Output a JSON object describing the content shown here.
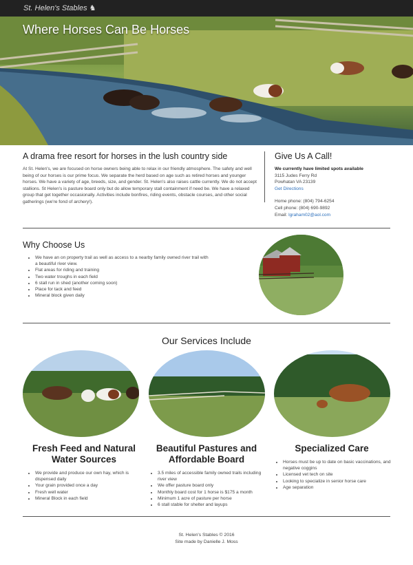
{
  "navbar": {
    "brand": "St. Helen's Stables",
    "brand_icon": "horse-icon"
  },
  "hero": {
    "title": "Where Horses Can Be Horses"
  },
  "intro": {
    "heading": "A drama free resort for horses in the lush country side",
    "text": "At St. Helen's, we are focused on horse owners being able to relax in our friendly atmosphere. The safety and well being of our horses is our prime focus. We separate the herd based on age such as retired horses and younger horses. We have a variety of age, breeds, size, and gender. St. Helen's also raises cattle currently. We do not accept stallions. St Helen's is pasture board only but do allow temporary stall containment if need be. We have a relaxed group that get together occasionally. Activities include bonfires, riding events, obstacle courses, and other social gatherings (we're fond of archery!)."
  },
  "contact": {
    "heading": "Give Us A Call!",
    "availability": "We currently have limited spots available",
    "address_line1": "3115 Judes Ferry Rd",
    "address_line2": "Powhatan VA 23139",
    "directions_link": "Get Directions",
    "home_phone": "Home phone: (804) 794-6254",
    "cell_phone": "Cell phone: (804) 690-9892",
    "email_label": "Email: ",
    "email": "lgraham02@aol.com"
  },
  "why": {
    "heading": "Why Choose Us",
    "items": [
      "We have an on property trail as well as access to a nearby family owned river trail with a beautiful river view.",
      "Flat areas for riding and training",
      "Two water troughs in each field",
      "6 stall run in shed (another coming soon)",
      "Place for tack and feed",
      "Mineral block given daily"
    ]
  },
  "services": {
    "heading": "Our Services Include",
    "columns": [
      {
        "title": "Fresh Feed and Natural Water Sources",
        "items": [
          "We provide and produce our own hay, which is dispensed daily",
          "Your grain provided once a day",
          "Fresh well water",
          "Mineral Block in each field"
        ]
      },
      {
        "title": "Beautiful Pastures and Affordable Board",
        "items": [
          "3.5 miles of accessible family owned trails including river view",
          "We offer pasture board only",
          "Monthly board cost for 1 horse is $175 a month",
          "Minimum 1 acre of pasture per horse",
          "6 stall stable for shelter and layups"
        ]
      },
      {
        "title": "Specialized Care",
        "items": [
          "Horses must be up to date on basic vaccinations, and negative coggins",
          "Licensed vet tech on site",
          "Looking to specialize in senior horse care",
          "Age separation"
        ]
      }
    ]
  },
  "footer": {
    "copyright": "St. Helen's Stables © 2016",
    "credit": "Site made by Danielle J. Moss"
  }
}
